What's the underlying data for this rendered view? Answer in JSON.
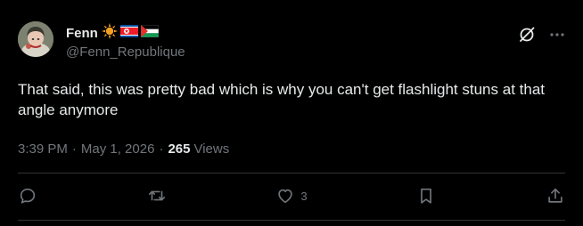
{
  "author": {
    "display_name": "Fenn",
    "handle": "@Fenn_Republique",
    "badges": [
      "sun-emoji-icon",
      "north-korea-flag-icon",
      "palestine-flag-icon"
    ]
  },
  "tweet": {
    "text": "That said, this was pretty bad which is why you can't get flashlight stuns at that angle anymore",
    "time": "3:39 PM",
    "separator": "·",
    "date": "May 1, 2026",
    "views_count": "265",
    "views_label": "Views"
  },
  "actions": {
    "like_count": "3"
  },
  "colors": {
    "background": "#000000",
    "text_primary": "#e7e9ea",
    "text_secondary": "#71767b",
    "divider": "#2f3336"
  }
}
